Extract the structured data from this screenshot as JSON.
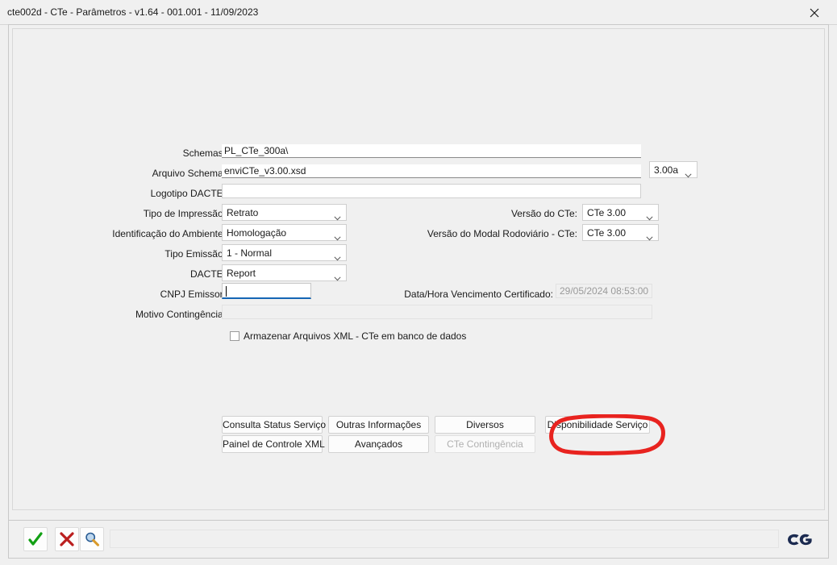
{
  "window": {
    "title": "cte002d - CTe - Parâmetros - v1.64 - 001.001 - 11/09/2023",
    "close_icon": "close-icon"
  },
  "form": {
    "schemas": {
      "label": "Schemas:",
      "value": "PL_CTe_300a\\"
    },
    "arquivo_schema": {
      "label": "Arquivo Schema:",
      "value": "enviCTe_v3.00.xsd"
    },
    "versao_schema_combo": {
      "value": "3.00a"
    },
    "logotipo_dacte": {
      "label": "Logotipo DACTE:",
      "value": ""
    },
    "tipo_impressao": {
      "label": "Tipo de Impressão:",
      "value": "Retrato"
    },
    "identificacao_ambiente": {
      "label": "Identificação do Ambiente:",
      "value": "Homologação"
    },
    "tipo_emissao": {
      "label": "Tipo Emissão:",
      "value": "1 - Normal"
    },
    "dacte": {
      "label": "DACTE:",
      "value": "Report"
    },
    "cnpj_emissor": {
      "label": "CNPJ Emissor:",
      "value": ""
    },
    "motivo_contingencia": {
      "label": "Motivo Contingência:",
      "value": ""
    },
    "versao_cte": {
      "label": "Versão do CTe:",
      "value": "CTe 3.00"
    },
    "versao_modal_rodoviario": {
      "label": "Versão do Modal Rodoviário - CTe:",
      "value": "CTe 3.00"
    },
    "data_hora_vencimento": {
      "label": "Data/Hora Vencimento Certificado:",
      "value": "29/05/2024 08:53:00"
    },
    "armazenar_xml": {
      "label": "Armazenar Arquivos XML - CTe em banco de dados",
      "checked": false
    }
  },
  "buttons": {
    "consulta_status_servico": "Consulta Status Serviço",
    "outras_informacoes": "Outras Informações",
    "diversos": "Diversos",
    "disponibilidade_servico": "Disponibilidade Serviço",
    "painel_controle_xml": "Painel de Controle XML",
    "avancados": "Avançados",
    "cte_contingencia": "CTe Contingência"
  },
  "toolbar": {
    "confirm_icon": "check-icon",
    "cancel_icon": "close-x-icon",
    "search_icon": "magnifier-icon",
    "status_text": "",
    "logo_text": "CG"
  },
  "annotation": {
    "color": "#e8231f",
    "target": "disponibilidade-servico-button"
  }
}
